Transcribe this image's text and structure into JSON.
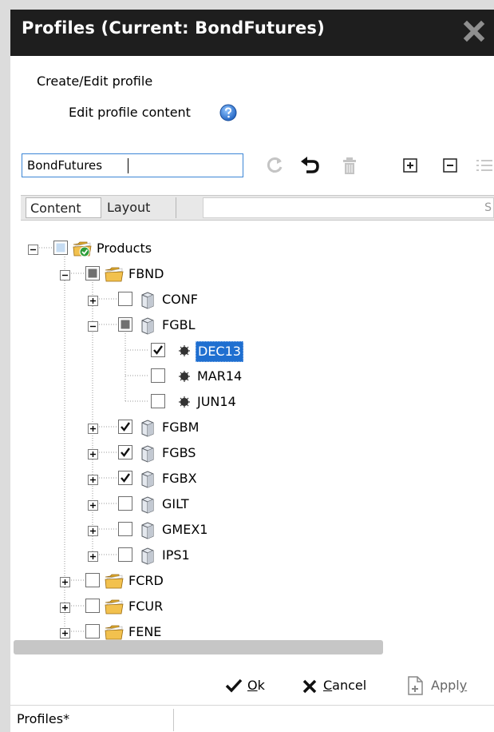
{
  "window": {
    "title": "Profiles (Current: BondFutures)"
  },
  "header": {
    "create_edit": "Create/Edit profile",
    "edit_content": "Edit profile content"
  },
  "profile_input": {
    "value": "BondFutures"
  },
  "tabs": [
    {
      "label": "Content",
      "active": true
    },
    {
      "label": "Layout",
      "active": false
    }
  ],
  "tab_search_partial": "S",
  "tree": [
    {
      "label": "Products",
      "icon": "folder-check-icon",
      "expander": "minus",
      "checkbox": "partial"
    },
    {
      "label": "FBND",
      "icon": "folder-icon",
      "expander": "minus",
      "checkbox": "partial-dark"
    },
    {
      "label": "CONF",
      "icon": "cube-icon",
      "expander": "plus",
      "checkbox": "unchecked"
    },
    {
      "label": "FGBL",
      "icon": "cube-icon",
      "expander": "minus",
      "checkbox": "partial-dark"
    },
    {
      "label": "DEC13",
      "icon": "dot-icon",
      "expander": "none",
      "checkbox": "checked",
      "selected": true
    },
    {
      "label": "MAR14",
      "icon": "dot-icon",
      "expander": "none",
      "checkbox": "unchecked"
    },
    {
      "label": "JUN14",
      "icon": "dot-icon",
      "expander": "none",
      "checkbox": "unchecked"
    },
    {
      "label": "FGBM",
      "icon": "cube-icon",
      "expander": "plus",
      "checkbox": "checked"
    },
    {
      "label": "FGBS",
      "icon": "cube-icon",
      "expander": "plus",
      "checkbox": "checked"
    },
    {
      "label": "FGBX",
      "icon": "cube-icon",
      "expander": "plus",
      "checkbox": "checked"
    },
    {
      "label": "GILT",
      "icon": "cube-icon",
      "expander": "plus",
      "checkbox": "unchecked"
    },
    {
      "label": "GMEX1",
      "icon": "cube-icon",
      "expander": "plus",
      "checkbox": "unchecked"
    },
    {
      "label": "IPS1",
      "icon": "cube-icon",
      "expander": "plus",
      "checkbox": "unchecked"
    },
    {
      "label": "FCRD",
      "icon": "folder-icon",
      "expander": "plus",
      "checkbox": "unchecked"
    },
    {
      "label": "FCUR",
      "icon": "folder-icon",
      "expander": "plus",
      "checkbox": "unchecked"
    },
    {
      "label": "FENE",
      "icon": "folder-icon",
      "expander": "plus",
      "checkbox": "unchecked"
    }
  ],
  "buttons": {
    "ok_mnemonic": "O",
    "ok_rest": "k",
    "cancel_mnemonic": "C",
    "cancel_rest": "ancel",
    "apply_text": "Appl",
    "apply_mnemonic": "y"
  },
  "status": {
    "text": "Profiles*"
  },
  "colors": {
    "titlebar": "#1e1e1e",
    "selection": "#1f6fd0",
    "input_border": "#3c86d6"
  }
}
